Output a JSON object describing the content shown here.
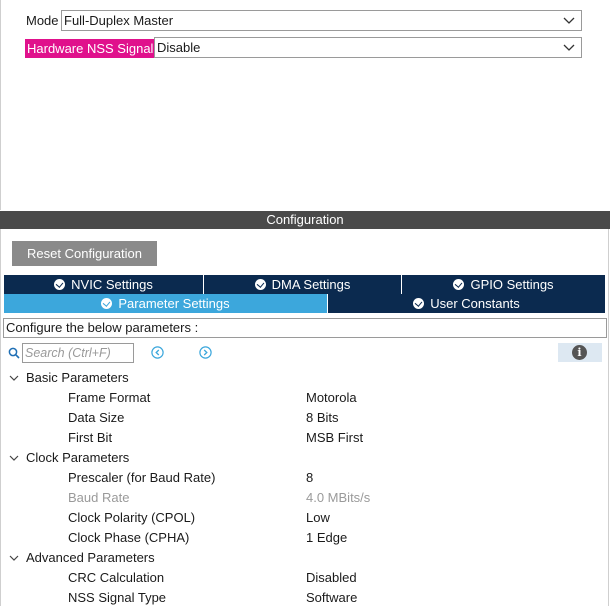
{
  "mode": {
    "label": "Mode",
    "value": "Full-Duplex Master"
  },
  "nss": {
    "label": "Hardware NSS Signal",
    "value": "Disable"
  },
  "configuration": {
    "title": "Configuration",
    "reset_label": "Reset Configuration",
    "tabs": [
      {
        "label": "NVIC Settings"
      },
      {
        "label": "DMA Settings"
      },
      {
        "label": "GPIO Settings"
      },
      {
        "label": "Parameter Settings"
      },
      {
        "label": "User Constants"
      }
    ],
    "configure_text": "Configure the below parameters :",
    "search_placeholder": "Search (Ctrl+F)",
    "info_glyph": "i",
    "groups": [
      {
        "name": "Basic Parameters",
        "rows": [
          {
            "label": "Frame Format",
            "value": "Motorola"
          },
          {
            "label": "Data Size",
            "value": "8 Bits"
          },
          {
            "label": "First Bit",
            "value": "MSB First"
          }
        ]
      },
      {
        "name": "Clock Parameters",
        "rows": [
          {
            "label": "Prescaler (for Baud Rate)",
            "value": "8"
          },
          {
            "label": "Baud Rate",
            "value": "4.0 MBits/s"
          },
          {
            "label": "Clock Polarity (CPOL)",
            "value": "Low"
          },
          {
            "label": "Clock Phase (CPHA)",
            "value": "1 Edge"
          }
        ]
      },
      {
        "name": "Advanced Parameters",
        "rows": [
          {
            "label": "CRC Calculation",
            "value": "Disabled"
          },
          {
            "label": "NSS Signal Type",
            "value": "Software"
          }
        ]
      }
    ]
  },
  "colors": {
    "accent_tab": "#3ca7dc",
    "tab_dark": "#0b2a4f",
    "highlight": "#e0118c",
    "header_bar": "#4a4a4a"
  }
}
